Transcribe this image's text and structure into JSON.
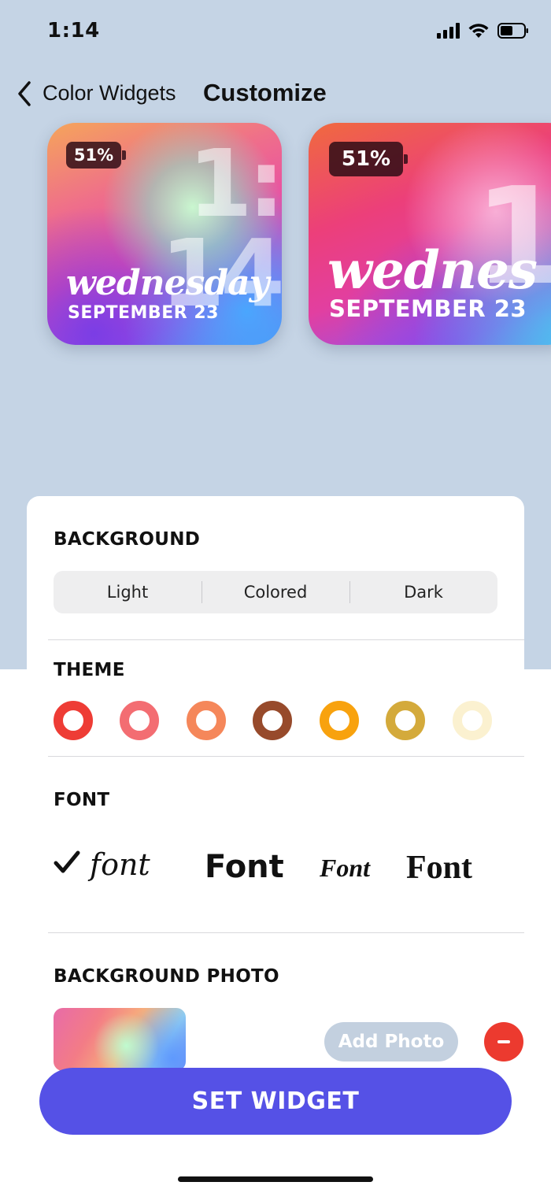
{
  "status_bar": {
    "time": "1:14",
    "icons": [
      "signal-icon",
      "wifi-icon",
      "battery-icon"
    ]
  },
  "nav": {
    "back_label": "Color Widgets",
    "title": "Customize"
  },
  "widgets": [
    {
      "battery": "51%",
      "time_top": "1:",
      "time_bottom": "14",
      "day": "wednesday",
      "date": "SEPTEMBER 23"
    },
    {
      "battery": "51%",
      "time_top": "1",
      "day": "wednes",
      "date": "SEPTEMBER 23"
    }
  ],
  "background_section": {
    "title": "BACKGROUND",
    "options": [
      "Light",
      "Colored",
      "Dark"
    ]
  },
  "theme_section": {
    "title": "THEME",
    "colors": [
      "#ee3c35",
      "#f36d72",
      "#f5875a",
      "#974a2b",
      "#f8a20e",
      "#d4aa3b",
      "#fbf1d0"
    ]
  },
  "font_section": {
    "title": "FONT",
    "options": [
      {
        "label": "font",
        "selected": true
      },
      {
        "label": "Font",
        "selected": false
      },
      {
        "label": "Font",
        "selected": false
      },
      {
        "label": "Font",
        "selected": false
      }
    ]
  },
  "photo_section": {
    "title": "BACKGROUND PHOTO",
    "add_label": "Add Photo"
  },
  "primary_action": {
    "label": "SET WIDGET"
  },
  "colors": {
    "accent": "#5551e6",
    "top_background": "#c5d4e5",
    "remove": "#ec3a2f"
  }
}
